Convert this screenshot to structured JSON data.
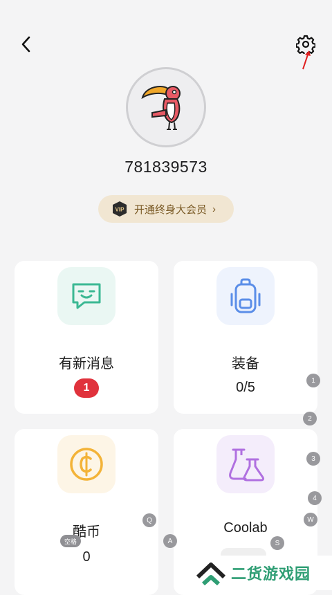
{
  "header": {
    "back_icon": "chevron-left-icon",
    "settings_icon": "gear-icon"
  },
  "profile": {
    "avatar_icon": "toucan-avatar",
    "username": "781839573",
    "vip": {
      "label": "开通终身大会员",
      "chevron": "›",
      "badge_text": "VIP"
    }
  },
  "cards": [
    {
      "title": "有新消息",
      "badge": "1",
      "icon": "message-icon"
    },
    {
      "title": "装备",
      "value": "0/5",
      "icon": "backpack-icon"
    },
    {
      "title": "酷币",
      "value": "0",
      "icon": "coin-icon"
    },
    {
      "title": "Coolab",
      "value": "",
      "icon": "flask-icon"
    }
  ],
  "overlay_keys": {
    "k1": "1",
    "k2": "2",
    "k3": "3",
    "k4": "4",
    "q": "Q",
    "w": "W",
    "a": "A",
    "s": "S",
    "space": "空格"
  },
  "watermark": {
    "text": "二货游戏园"
  },
  "colors": {
    "background": "#f4f4f5",
    "vip_bg": "#f1e6d2",
    "vip_text": "#7a5a25",
    "badge_red": "#e0323c",
    "message_tint": "#eaf7f3",
    "backpack_tint": "#eef3fd",
    "coin_tint": "#fdf5e6",
    "flask_tint": "#f4edfb",
    "watermark_green": "#2f9e74"
  }
}
